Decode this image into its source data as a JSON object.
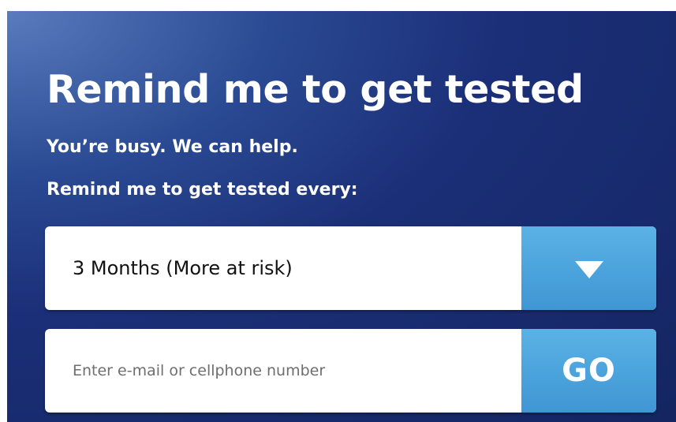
{
  "widget": {
    "title": "Remind me to get tested",
    "subtitle": "You’re busy. We can help.",
    "prompt": "Remind me to get tested every:"
  },
  "frequency_select": {
    "selected": "3 Months (More at risk)",
    "icon": "triangle-down-icon"
  },
  "contact": {
    "placeholder": "Enter e-mail or cellphone number",
    "value": "",
    "submit_label": "GO"
  },
  "colors": {
    "panel_dark": "#142561",
    "panel_light": "#5a7bbd",
    "accent_blue": "#4aa3dc",
    "text_white": "#ffffff"
  }
}
